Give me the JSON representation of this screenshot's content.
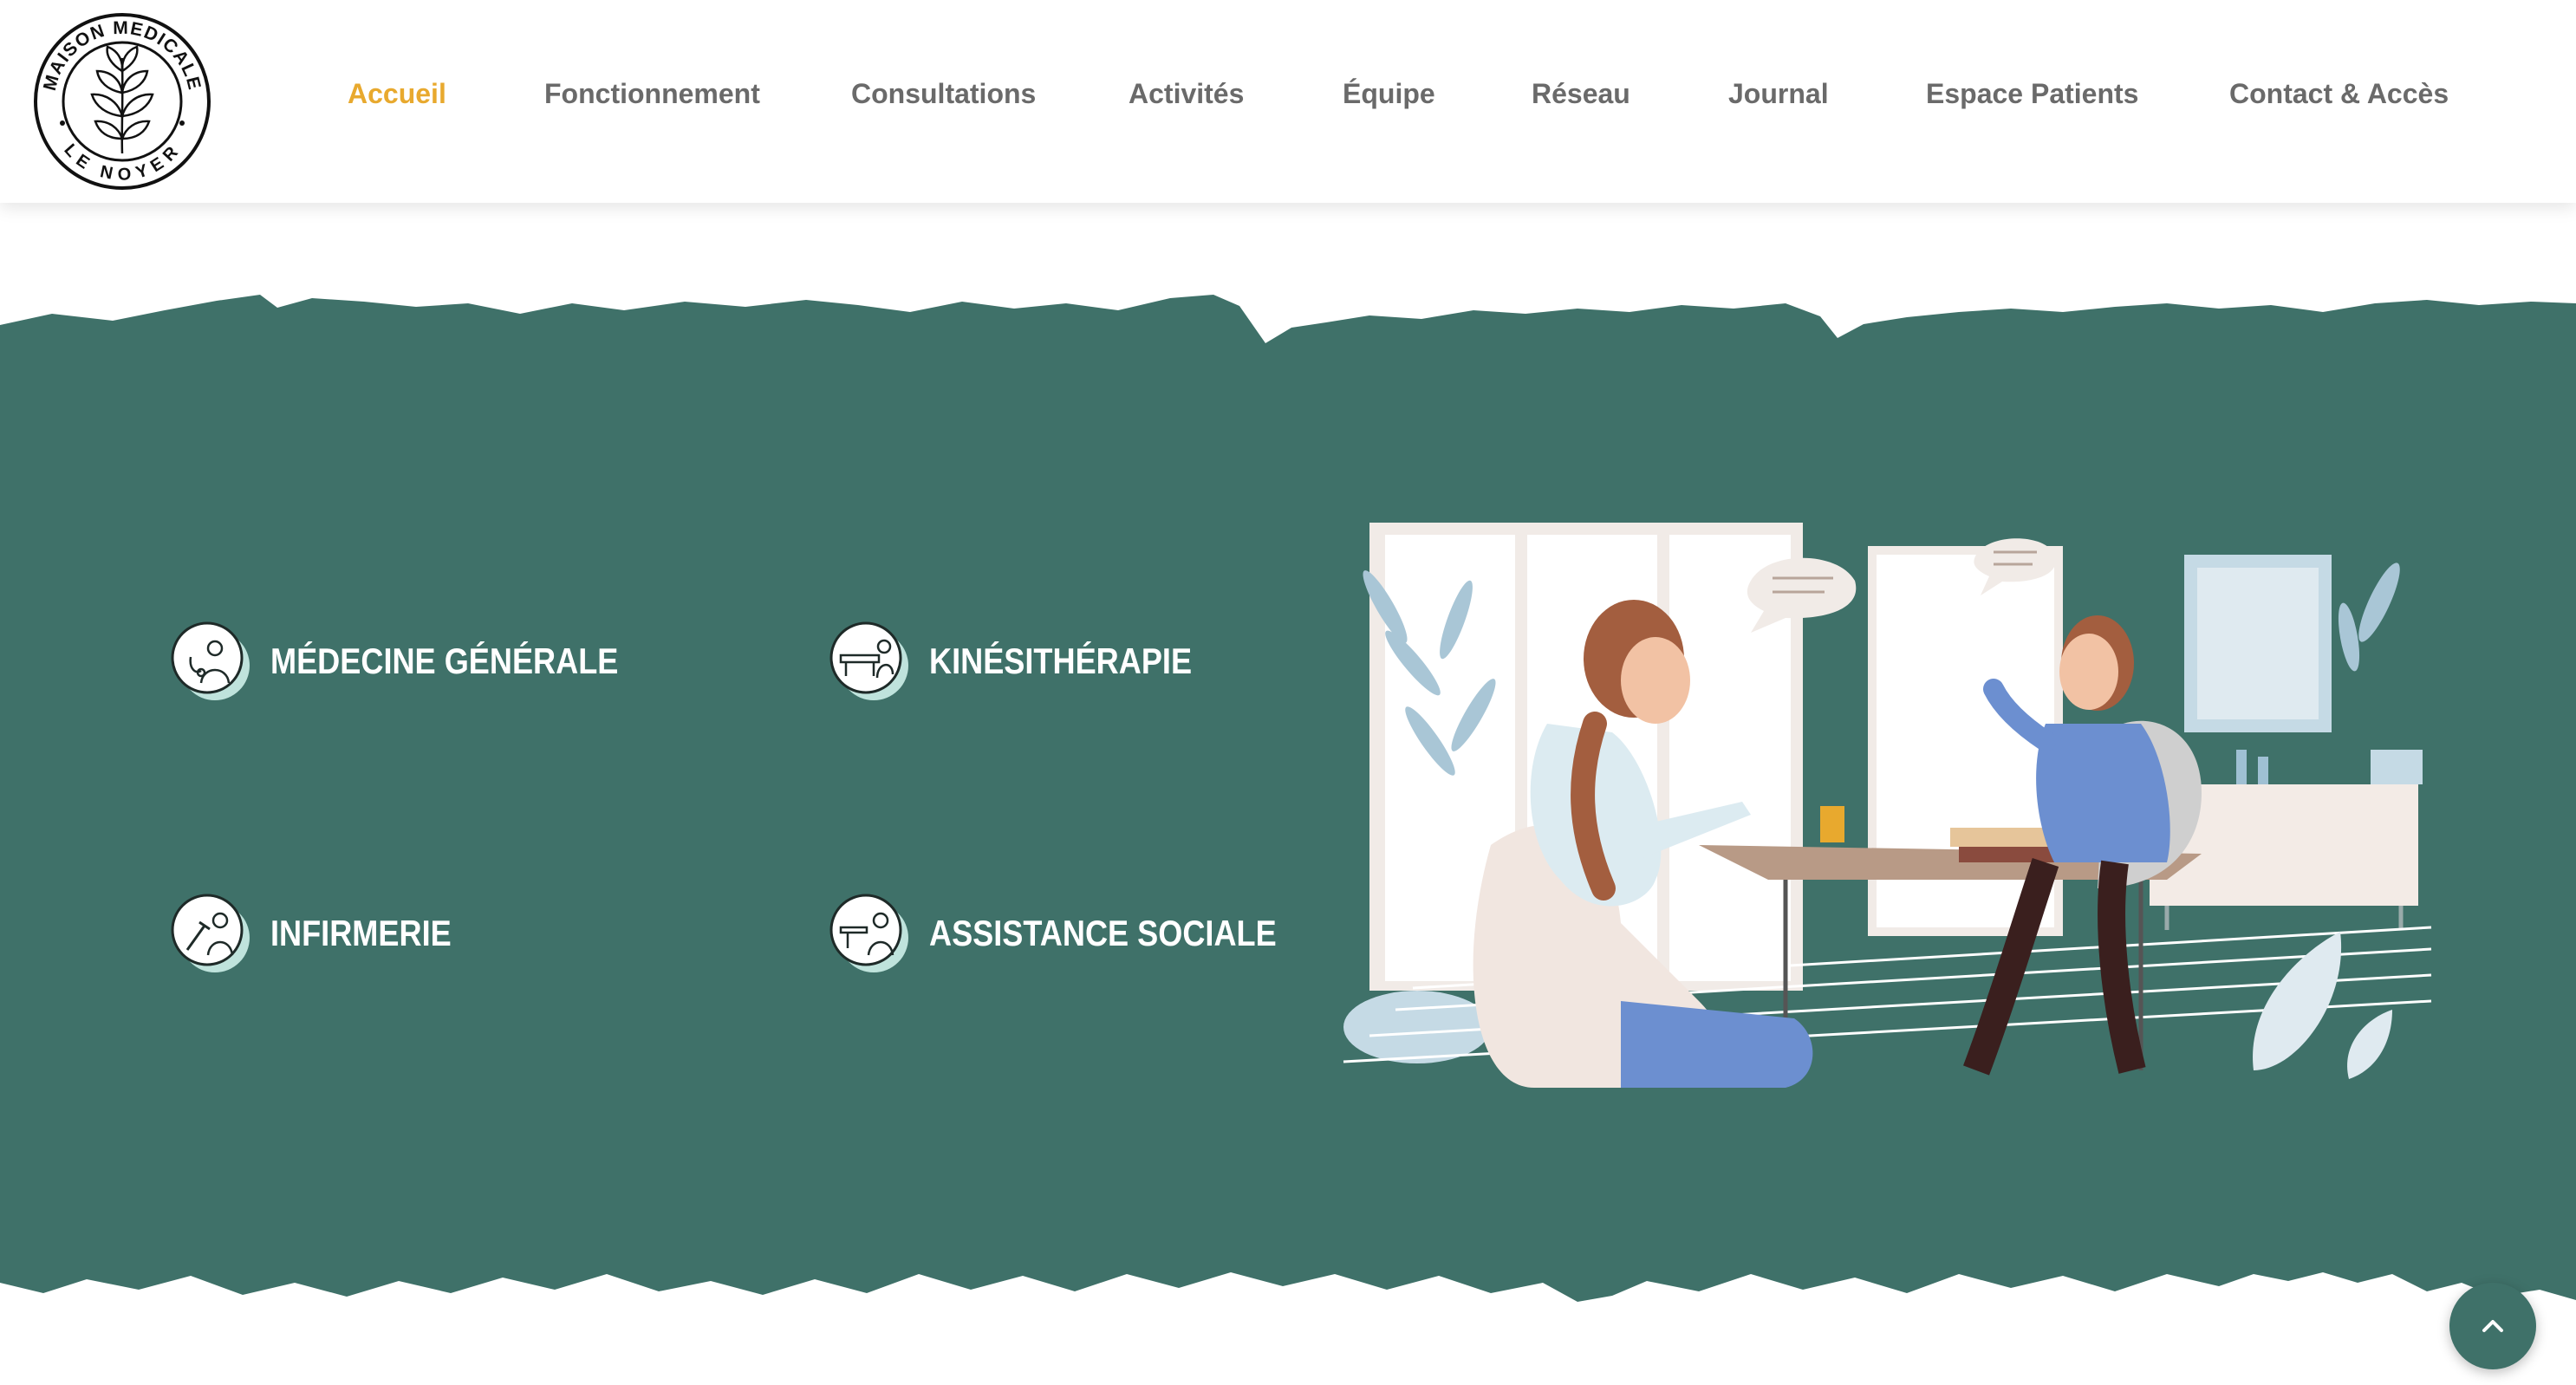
{
  "header": {
    "logo_top_text": "MAISON MEDICALE",
    "logo_bottom_text": "LE NOYER",
    "nav": [
      {
        "label": "Accueil",
        "active": true
      },
      {
        "label": "Fonctionnement",
        "active": false
      },
      {
        "label": "Consultations",
        "active": false
      },
      {
        "label": "Activités",
        "active": false
      },
      {
        "label": "Équipe",
        "active": false
      },
      {
        "label": "Réseau",
        "active": false
      },
      {
        "label": "Journal",
        "active": false
      },
      {
        "label": "Espace Patients",
        "active": false
      },
      {
        "label": "Contact & Accès",
        "active": false
      }
    ]
  },
  "services": [
    {
      "label": "MÉDECINE GÉNÉRALE",
      "icon": "doctor-stethoscope-icon"
    },
    {
      "label": "KINÉSITHÉRAPIE",
      "icon": "physiotherapy-table-icon"
    },
    {
      "label": "INFIRMERIE",
      "icon": "nurse-syringe-icon"
    },
    {
      "label": "ASSISTANCE SOCIALE",
      "icon": "social-assistance-icon"
    }
  ],
  "illustration": "consultation-scene-illustration",
  "colors": {
    "band": "#3f7169",
    "accent_nav": "#e8a92e",
    "nav_text": "#6a6a6a",
    "icon_mint": "#bfe3dc"
  },
  "scroll_top_icon": "chevron-up-icon"
}
